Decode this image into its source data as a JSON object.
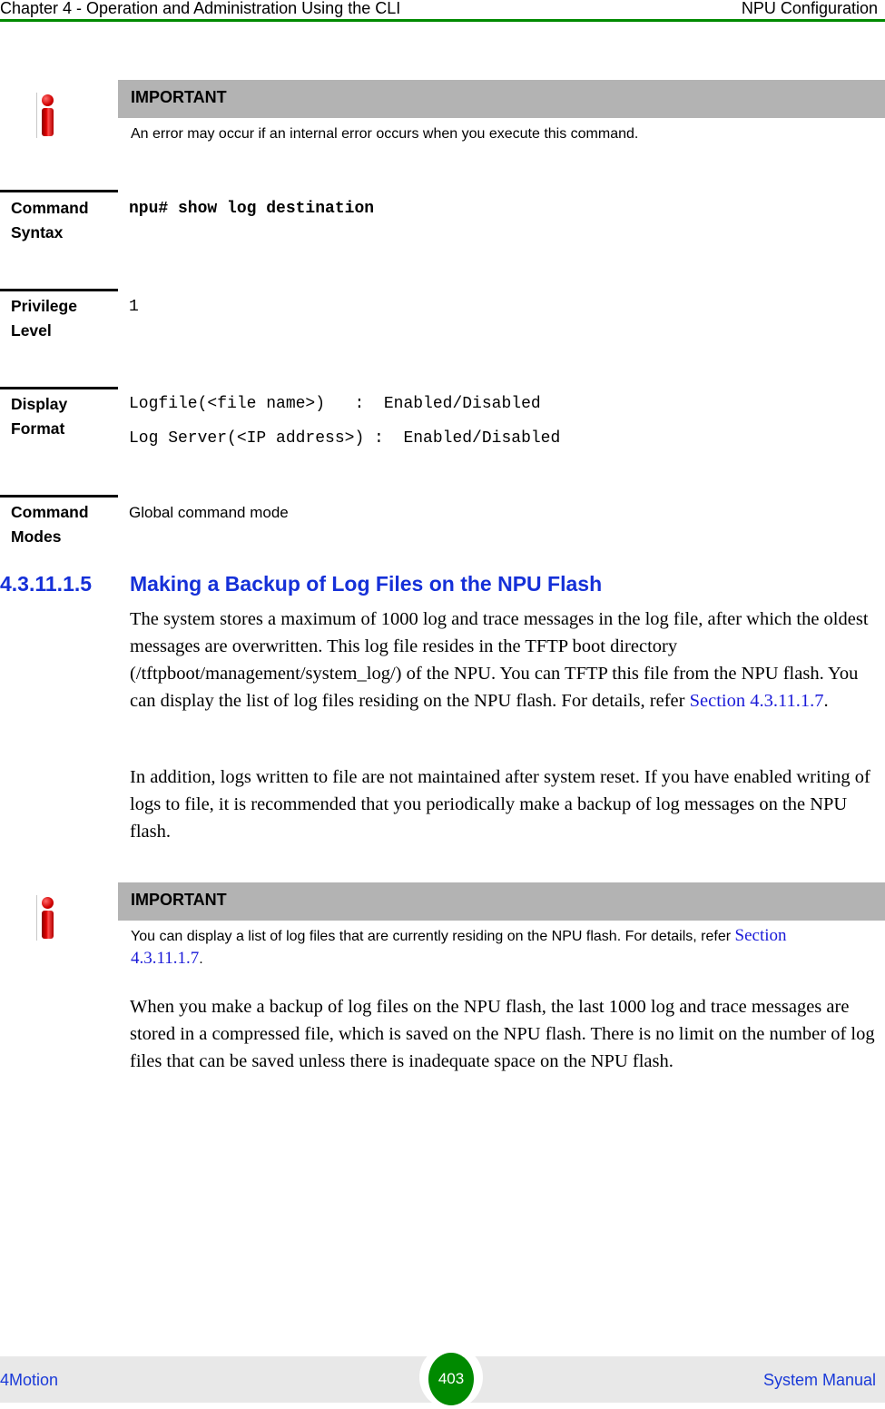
{
  "header": {
    "chapter": "Chapter 4 - Operation and Administration Using the CLI",
    "section": "NPU Configuration"
  },
  "important_1": {
    "title": "IMPORTANT",
    "text": "An error may occur if an internal error occurs when you execute this command."
  },
  "command_table": {
    "rows": [
      {
        "label": "Command Syntax",
        "values": [
          "npu# show log destination"
        ]
      },
      {
        "label": "Privilege Level",
        "values": [
          "1"
        ]
      },
      {
        "label": "Display Format",
        "values": [
          "Logfile(<file name>)   :  Enabled/Disabled",
          "Log Server(<IP address>) :  Enabled/Disabled"
        ]
      },
      {
        "label": "Command Modes",
        "values": [
          "Global command mode"
        ]
      }
    ]
  },
  "section": {
    "number": "4.3.11.1.5",
    "title": "Making a Backup of Log Files on the NPU Flash"
  },
  "paragraphs": {
    "p1_text": "The system stores a maximum of 1000 log and trace messages in the log file, after which the oldest messages are overwritten. This log file resides in the TFTP boot directory (/tftpboot/management/system_log/) of the NPU. You can TFTP this file from the NPU flash. You can display the list of log files residing on the NPU flash. For details, refer ",
    "p1_link": "Section 4.3.11.1.7",
    "p1_end": ".",
    "p2_text": "In addition, logs written to file are not maintained after system reset. If you have enabled writing of logs to file, it is recommended that you periodically make a backup of log messages on the NPU flash.",
    "p3_text": "When you make a backup of log files on the NPU flash, the last 1000 log and trace messages are stored in a compressed file, which is saved on the NPU flash. There is no limit on the number of log files that can be saved unless there is inadequate space on the NPU flash."
  },
  "important_2": {
    "title": "IMPORTANT",
    "text": "You can display a list of log files that are currently residing on the NPU flash. For details, refer ",
    "link": "Section 4.3.11.1.7",
    "end": "."
  },
  "footer": {
    "product": "4Motion",
    "page": "403",
    "manual": "System Manual"
  },
  "colors": {
    "accent_green": "#008a00",
    "heading_blue": "#1530d8",
    "link_blue": "#1a1ad8",
    "note_gray": "#b3b3b3"
  }
}
